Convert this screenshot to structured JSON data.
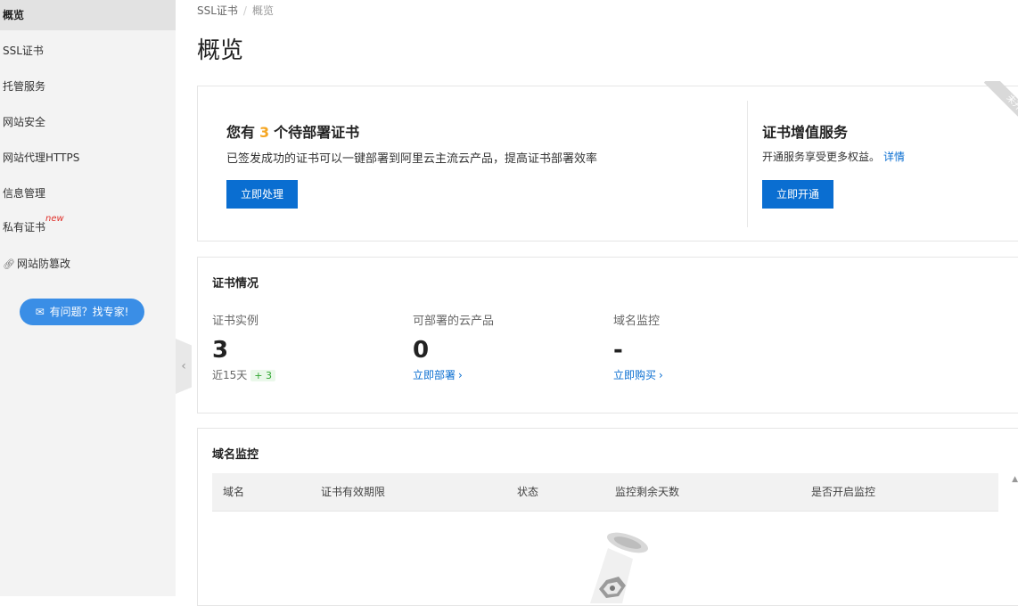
{
  "sidebar": {
    "items": [
      {
        "label": "概览",
        "active": true
      },
      {
        "label": "SSL证书"
      },
      {
        "label": "托管服务"
      },
      {
        "label": "网站安全"
      },
      {
        "label": "网站代理HTTPS"
      },
      {
        "label": "信息管理"
      },
      {
        "label": "私有证书",
        "tag": "new"
      },
      {
        "label": "网站防篡改",
        "icon": "link-icon"
      }
    ],
    "help_button": "有问题？找专家!",
    "collapse_icon": "‹"
  },
  "breadcrumb": {
    "root": "SSL证书",
    "separator": "/",
    "current": "概览"
  },
  "page_title": "概览",
  "pending": {
    "prefix": "您有",
    "count": "3",
    "suffix": "个待部署证书",
    "description": "已签发成功的证书可以一键部署到阿里云主流云产品，提高证书部署效率",
    "button": "立即处理"
  },
  "value_added": {
    "title": "证书增值服务",
    "description": "开通服务享受更多权益。",
    "link": "详情",
    "button": "立即开通",
    "ribbon": "未开"
  },
  "cert_status": {
    "title": "证书情况",
    "stats": [
      {
        "label": "证书实例",
        "value": "3",
        "sub": "近15天",
        "delta": "+ 3"
      },
      {
        "label": "可部署的云产品",
        "value": "0",
        "action": "立即部署"
      },
      {
        "label": "域名监控",
        "value": "-",
        "action": "立即购买"
      }
    ]
  },
  "domain_monitor": {
    "title": "域名监控",
    "columns": [
      "域名",
      "证书有效期限",
      "状态",
      "监控剩余天数",
      "是否开启监控"
    ]
  },
  "colors": {
    "primary": "#0a6ed1",
    "accent": "#f5a623",
    "help": "#3a8ee6"
  }
}
